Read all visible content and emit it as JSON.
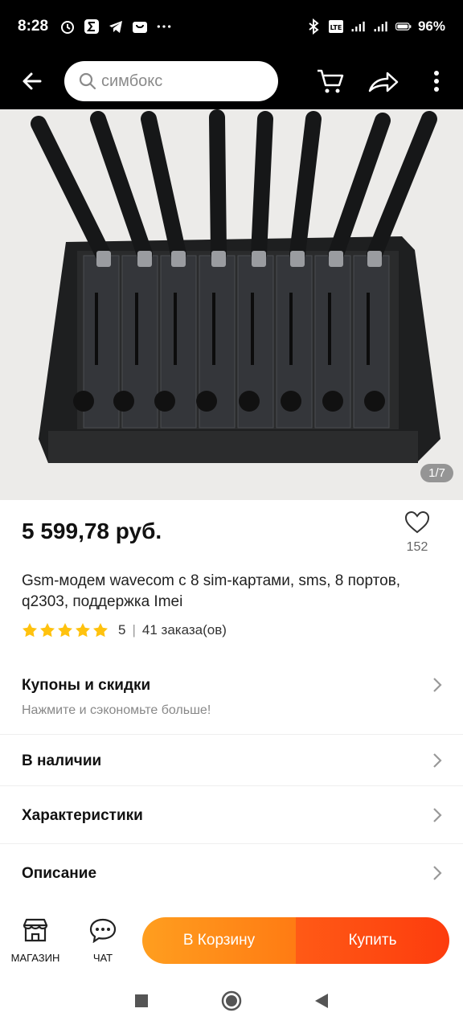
{
  "status_bar": {
    "time": "8:28",
    "battery": "96%"
  },
  "search": {
    "placeholder": "симбокс"
  },
  "gallery": {
    "counter": "1/7"
  },
  "product": {
    "price": "5 599,78 руб.",
    "favorites_count": "152",
    "title": "Gsm-модем wavecom с 8 sim-картами, sms, 8 портов, q2303, поддержка Imei",
    "rating": "5",
    "orders": "41 заказа(ов)"
  },
  "sections": {
    "coupons_title": "Купоны и скидки",
    "coupons_sub": "Нажмите и сэкономьте больше!",
    "stock": "В наличии",
    "specs": "Характеристики",
    "description": "Описание"
  },
  "bottom": {
    "store": "МАГАЗИН",
    "chat": "ЧАТ",
    "cart": "В Корзину",
    "buy": "Купить"
  },
  "colors": {
    "accent_orange": "#ff7b13",
    "buy_red": "#fd3c0d",
    "star": "#ffc20e"
  }
}
